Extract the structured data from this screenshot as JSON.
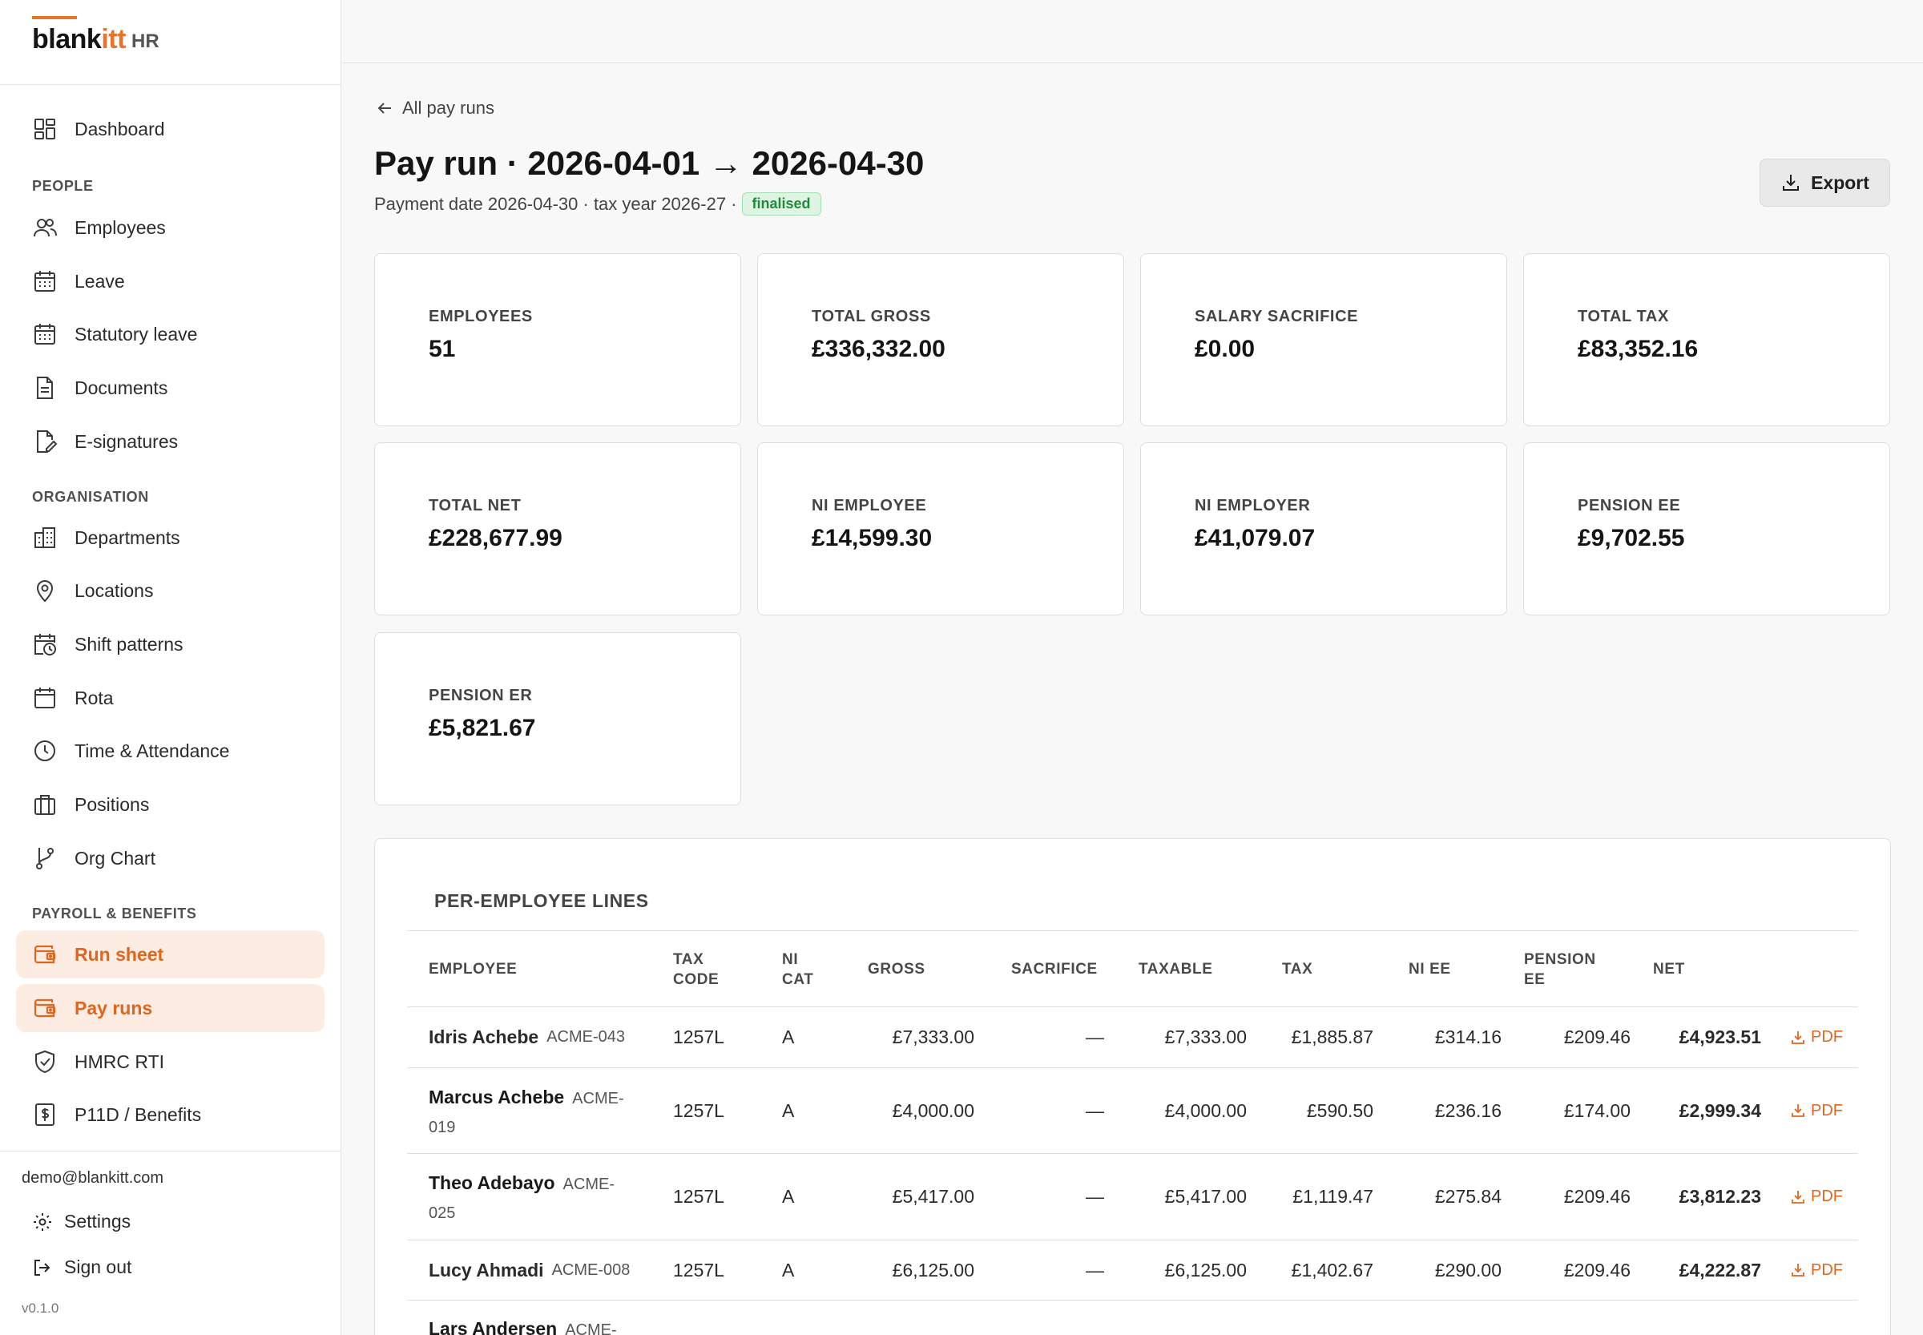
{
  "brand": {
    "logo_main": "blank",
    "logo_accent": "itt",
    "suffix": "HR"
  },
  "nav": {
    "dashboard": "Dashboard",
    "section_people": "PEOPLE",
    "employees": "Employees",
    "leave": "Leave",
    "statutory_leave": "Statutory leave",
    "documents": "Documents",
    "esignatures": "E-signatures",
    "section_organisation": "ORGANISATION",
    "departments": "Departments",
    "locations": "Locations",
    "shift_patterns": "Shift patterns",
    "rota": "Rota",
    "time_attendance": "Time & Attendance",
    "positions": "Positions",
    "org_chart": "Org Chart",
    "section_payroll": "PAYROLL & BENEFITS",
    "run_sheet": "Run sheet",
    "pay_runs": "Pay runs",
    "hmrc_rti": "HMRC RTI",
    "p11d": "P11D / Benefits"
  },
  "footer": {
    "email": "demo@blankitt.com",
    "settings": "Settings",
    "sign_out": "Sign out",
    "version": "v0.1.0"
  },
  "header": {
    "back_label": "All pay runs",
    "title": "Pay run · 2026-04-01 → 2026-04-30",
    "subtitle": "Payment date 2026-04-30 · tax year 2026-27 ·",
    "status": "finalised",
    "export_label": "Export"
  },
  "stats": [
    {
      "label": "EMPLOYEES",
      "value": "51"
    },
    {
      "label": "TOTAL GROSS",
      "value": "£336,332.00"
    },
    {
      "label": "SALARY SACRIFICE",
      "value": "£0.00"
    },
    {
      "label": "TOTAL TAX",
      "value": "£83,352.16"
    },
    {
      "label": "TOTAL NET",
      "value": "£228,677.99"
    },
    {
      "label": "NI EMPLOYEE",
      "value": "£14,599.30"
    },
    {
      "label": "NI EMPLOYER",
      "value": "£41,079.07"
    },
    {
      "label": "PENSION EE",
      "value": "£9,702.55"
    },
    {
      "label": "PENSION ER",
      "value": "£5,821.67"
    }
  ],
  "lines": {
    "title": "PER-EMPLOYEE LINES",
    "columns": {
      "employee": "EMPLOYEE",
      "tax_code_1": "TAX",
      "tax_code_2": "CODE",
      "ni_cat_1": "NI",
      "ni_cat_2": "CAT",
      "gross": "GROSS",
      "sacrifice": "SACRIFICE",
      "taxable": "TAXABLE",
      "tax": "TAX",
      "ni_ee": "NI EE",
      "pension_ee_1": "PENSION",
      "pension_ee_2": "EE",
      "net": "NET"
    },
    "pdf_label": "PDF",
    "rows": [
      {
        "name": "Idris Achebe",
        "code": "ACME-043",
        "tax_code": "1257L",
        "ni_cat": "A",
        "gross": "£7,333.00",
        "sacrifice": "—",
        "taxable": "£7,333.00",
        "tax": "£1,885.87",
        "ni_ee": "£314.16",
        "pension_ee": "£209.46",
        "net": "£4,923.51"
      },
      {
        "name": "Marcus Achebe",
        "code": "ACME-019",
        "tax_code": "1257L",
        "ni_cat": "A",
        "gross": "£4,000.00",
        "sacrifice": "—",
        "taxable": "£4,000.00",
        "tax": "£590.50",
        "ni_ee": "£236.16",
        "pension_ee": "£174.00",
        "net": "£2,999.34"
      },
      {
        "name": "Theo Adebayo",
        "code": "ACME-025",
        "tax_code": "1257L",
        "ni_cat": "A",
        "gross": "£5,417.00",
        "sacrifice": "—",
        "taxable": "£5,417.00",
        "tax": "£1,119.47",
        "ni_ee": "£275.84",
        "pension_ee": "£209.46",
        "net": "£3,812.23"
      },
      {
        "name": "Lucy Ahmadi",
        "code": "ACME-008",
        "tax_code": "1257L",
        "ni_cat": "A",
        "gross": "£6,125.00",
        "sacrifice": "—",
        "taxable": "£6,125.00",
        "tax": "£1,402.67",
        "ni_ee": "£290.00",
        "pension_ee": "£209.46",
        "net": "£4,222.87"
      },
      {
        "name": "Lars Andersen",
        "code": "ACME-",
        "tax_code": "",
        "ni_cat": "",
        "gross": "",
        "sacrifice": "",
        "taxable": "",
        "tax": "",
        "ni_ee": "",
        "pension_ee": "",
        "net": ""
      }
    ]
  },
  "colors": {
    "accent": "#e1661d",
    "success_bg": "#dff5e3",
    "success_text": "#1f8a3c"
  }
}
